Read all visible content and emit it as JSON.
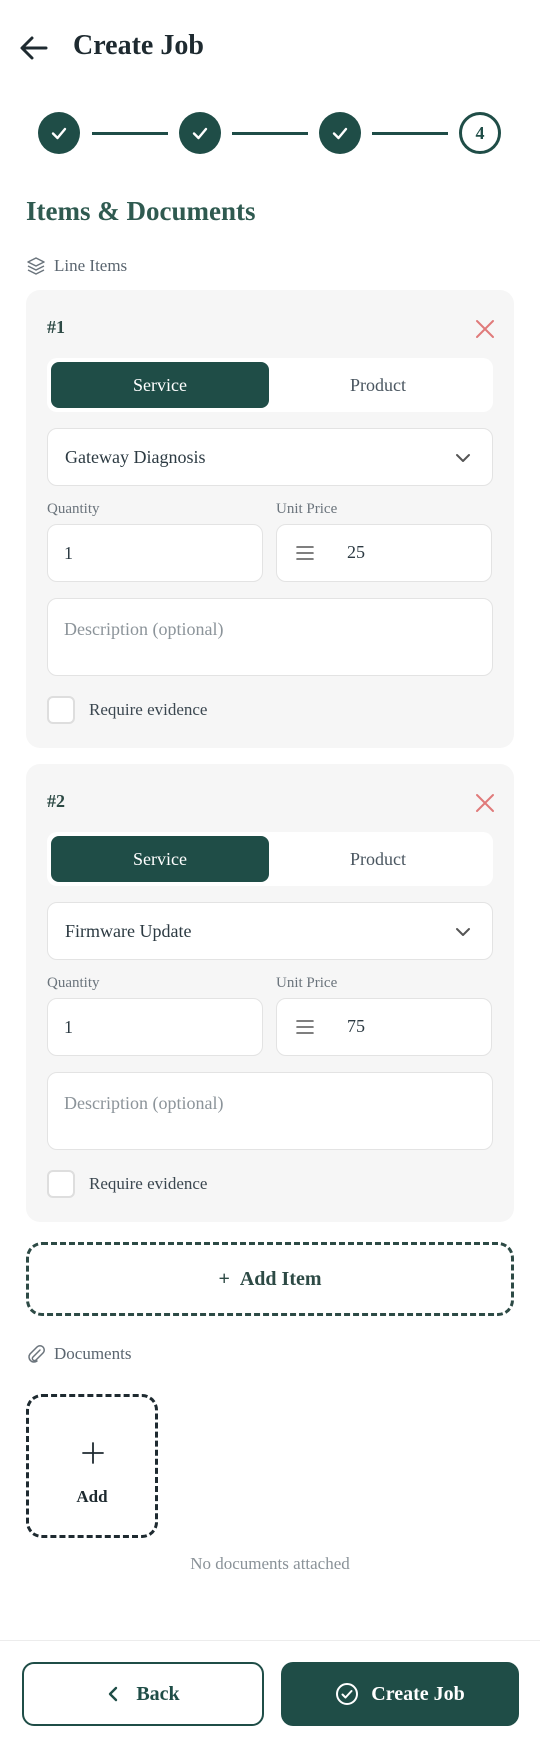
{
  "header": {
    "title": "Create Job"
  },
  "stepper": {
    "current_step": "4"
  },
  "section_title": "Items & Documents",
  "line_items_label": "Line Items",
  "items": [
    {
      "number": "#1",
      "type_options": [
        "Service",
        "Product"
      ],
      "selected_type": "Service",
      "selected_item": "Gateway Diagnosis",
      "quantity_label": "Quantity",
      "quantity": "1",
      "unit_price_label": "Unit Price",
      "unit_price": "25",
      "description_placeholder": "Description (optional)",
      "require_evidence_label": "Require evidence"
    },
    {
      "number": "#2",
      "type_options": [
        "Service",
        "Product"
      ],
      "selected_type": "Service",
      "selected_item": "Firmware Update",
      "quantity_label": "Quantity",
      "quantity": "1",
      "unit_price_label": "Unit Price",
      "unit_price": "75",
      "description_placeholder": "Description (optional)",
      "require_evidence_label": "Require evidence"
    }
  ],
  "add_item_label": "Add Item",
  "documents": {
    "label": "Documents",
    "add_label": "Add",
    "empty_text": "No documents attached"
  },
  "footer": {
    "back_label": "Back",
    "create_label": "Create Job"
  },
  "colors": {
    "primary": "#1f4d47",
    "danger": "#e07a7a",
    "card_bg": "#f6f6f6"
  }
}
